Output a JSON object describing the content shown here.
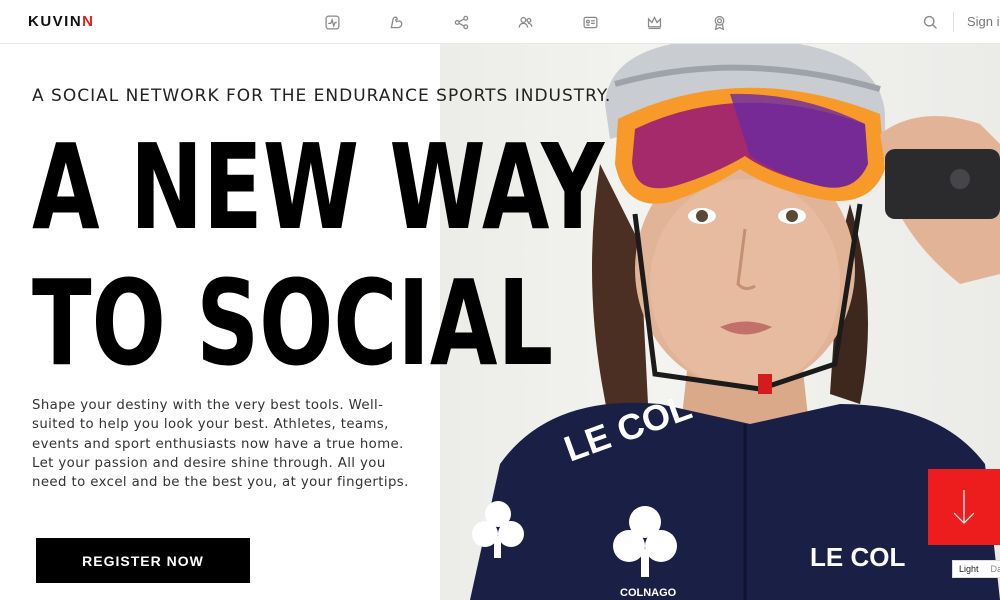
{
  "brand": {
    "logo_main": "KUVIN",
    "logo_accent": "N",
    "accent_color": "#e3201b"
  },
  "header": {
    "nav_icons": [
      "activity-icon",
      "muscle-icon",
      "share-icon",
      "users-icon",
      "id-card-icon",
      "crown-icon",
      "medal-icon"
    ],
    "search_icon": "search-icon",
    "signin_label": "Sign in"
  },
  "hero": {
    "tagline": "A SOCIAL NETWORK FOR THE ENDURANCE SPORTS INDUSTRY.",
    "headline_line1": "A NEW WAY",
    "headline_line2": "TO SOCIAL",
    "description": "Shape your destiny with the very best tools. Well-suited to help you look your best. Athletes, teams, events and sport enthusiasts now have a true home. Let your passion and desire shine through. All you need to excel and be the best you, at your fingertips.",
    "cta_label": "REGISTER NOW"
  },
  "photo": {
    "jersey_brand": "LE COL",
    "jersey_sponsor": "COLNAGO"
  },
  "scroll": {
    "icon": "arrow-down-icon",
    "color": "#ee1d1d"
  },
  "theme_toggle": {
    "light_label": "Light",
    "dark_label": "Dark"
  }
}
